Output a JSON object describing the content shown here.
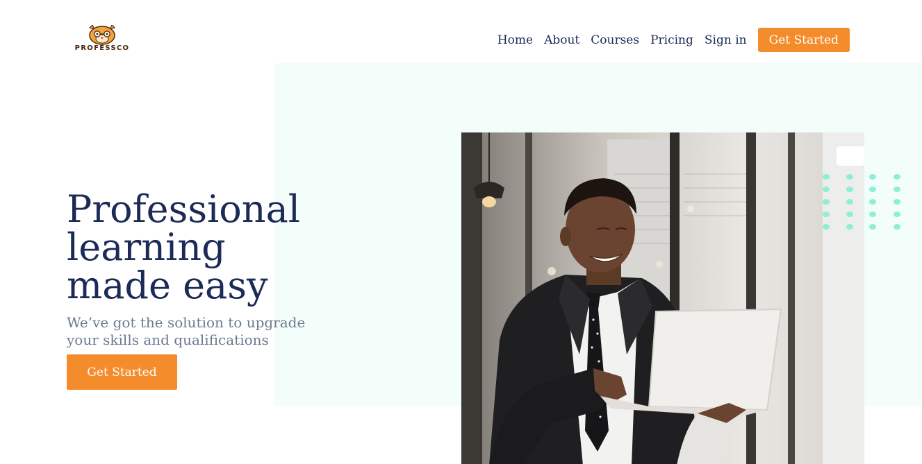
{
  "brand": {
    "name": "PROFESSCO",
    "logo_icon": "cat-face-logo-icon"
  },
  "nav": {
    "items": [
      {
        "label": "Home"
      },
      {
        "label": "About"
      },
      {
        "label": "Courses"
      },
      {
        "label": "Pricing"
      },
      {
        "label": "Sign in"
      }
    ],
    "cta_label": "Get Started"
  },
  "hero": {
    "title": "Professional learning made easy",
    "subtitle": "We’ve got the solution to upgrade your skills and qualifications",
    "cta_label": "Get Started",
    "photo_icon": "man-with-laptop-photo",
    "decoration_icon": "dot-grid-icon"
  },
  "colors": {
    "primary_text": "#1b2a57",
    "accent": "#f48c2b",
    "muted_text": "#6b7a90",
    "panel_bg": "#f3fdfa",
    "dot_color": "#8fefd6"
  }
}
